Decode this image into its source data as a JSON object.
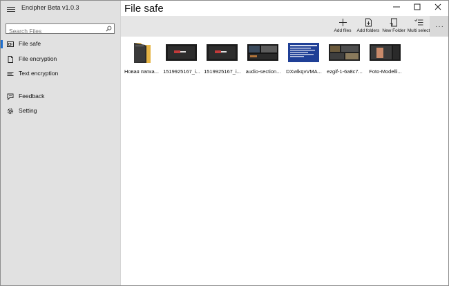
{
  "app": {
    "title": "Encipher  Beta v1.0.3"
  },
  "search": {
    "placeholder": "Search Files"
  },
  "nav": {
    "items": [
      {
        "id": "file-safe",
        "label": "File safe",
        "icon": "safe-icon",
        "selected": true
      },
      {
        "id": "file-encryption",
        "label": "File encryption",
        "icon": "document-icon",
        "selected": false
      },
      {
        "id": "text-encryption",
        "label": "Text encryption",
        "icon": "text-lines-icon",
        "selected": false
      },
      {
        "id": "feedback",
        "label": "Feedback",
        "icon": "feedback-icon",
        "selected": false
      },
      {
        "id": "setting",
        "label": "Setting",
        "icon": "gear-icon",
        "selected": false
      }
    ]
  },
  "main": {
    "title": "File safe"
  },
  "commands": [
    {
      "id": "add-files",
      "label": "Add files",
      "icon": "plus-icon"
    },
    {
      "id": "add-folders",
      "label": "Add folders",
      "icon": "add-folder-icon"
    },
    {
      "id": "new-folder",
      "label": "New Folder",
      "icon": "new-folder-icon"
    },
    {
      "id": "multi-select",
      "label": "Multi select",
      "icon": "multi-select-icon"
    }
  ],
  "more": {
    "icon": "more-icon"
  },
  "files": [
    {
      "name": "Новая папка...",
      "kind": "folder"
    },
    {
      "name": "1519925167_i...",
      "kind": "image"
    },
    {
      "name": "1519925167_i...",
      "kind": "image"
    },
    {
      "name": "audio-section...",
      "kind": "image"
    },
    {
      "name": "DXwlkqvVMA...",
      "kind": "image"
    },
    {
      "name": "ezgif-1-6a8c7...",
      "kind": "image"
    },
    {
      "name": "Foto-Modelli...",
      "kind": "image"
    }
  ],
  "colors": {
    "accent": "#1e6fd0",
    "sidebar": "#e1e1e1",
    "cmdbar": "#e6e6e6"
  }
}
